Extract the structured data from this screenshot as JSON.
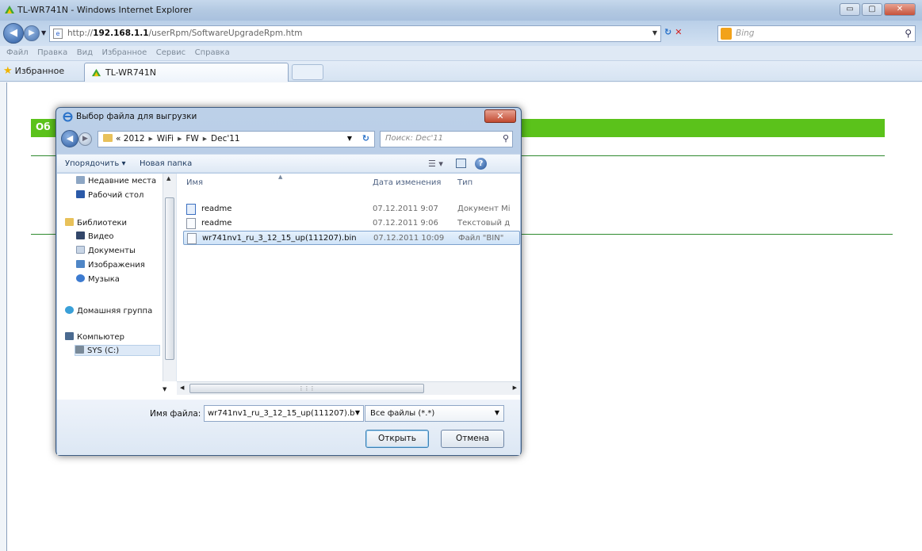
{
  "browser": {
    "window_title": "TL-WR741N - Windows Internet Explorer",
    "window_controls": [
      "▭",
      "▢",
      "✕"
    ],
    "url_prefix": "http://",
    "url_host": "192.168.1.1",
    "url_path": "/userRpm/SoftwareUpgradeRpm.htm",
    "search_placeholder": "Bing",
    "menu": [
      "Файл",
      "Правка",
      "Вид",
      "Избранное",
      "Сервис",
      "Справка"
    ],
    "favorites_label": "Избранное",
    "tab_title": "TL-WR741N"
  },
  "page": {
    "green_bar_text": "Об"
  },
  "dialog": {
    "title": "Выбор файла для выгрузки",
    "close_label": "✕",
    "breadcrumb": [
      "«",
      "2012",
      "WiFi",
      "FW",
      "Dec'11"
    ],
    "search_placeholder": "Поиск: Dec'11",
    "toolbar": {
      "organize": "Упорядочить ▾",
      "new_folder": "Новая папка"
    },
    "nav_items": [
      {
        "label": "Недавние места",
        "icon": "recent-places-icon"
      },
      {
        "label": "Рабочий стол",
        "icon": "desktop-icon"
      },
      {
        "label": "Библиотеки",
        "icon": "libraries-icon"
      },
      {
        "label": "Видео",
        "icon": "video-icon"
      },
      {
        "label": "Документы",
        "icon": "documents-icon"
      },
      {
        "label": "Изображения",
        "icon": "images-icon"
      },
      {
        "label": "Музыка",
        "icon": "music-icon"
      },
      {
        "label": "Домашняя группа",
        "icon": "homegroup-icon"
      },
      {
        "label": "Компьютер",
        "icon": "computer-icon"
      },
      {
        "label": "SYS (C:)",
        "icon": "drive-icon"
      }
    ],
    "columns": {
      "name": "Имя",
      "date": "Дата изменения",
      "type": "Тип"
    },
    "files": [
      {
        "name": "readme",
        "date": "07.12.2011 9:07",
        "type": "Документ Mi",
        "icon": "word-doc-icon"
      },
      {
        "name": "readme",
        "date": "07.12.2011 9:06",
        "type": "Текстовый д",
        "icon": "text-file-icon"
      },
      {
        "name": "wr741nv1_ru_3_12_15_up(111207).bin",
        "date": "07.12.2011 10:09",
        "type": "Файл \"BIN\"",
        "icon": "bin-file-icon",
        "selected": true
      }
    ],
    "filename_label": "Имя файла:",
    "filename_value": "wr741nv1_ru_3_12_15_up(111207).b",
    "filter_value": "Все файлы (*.*)",
    "open_button": "Открыть",
    "cancel_button": "Отмена"
  }
}
